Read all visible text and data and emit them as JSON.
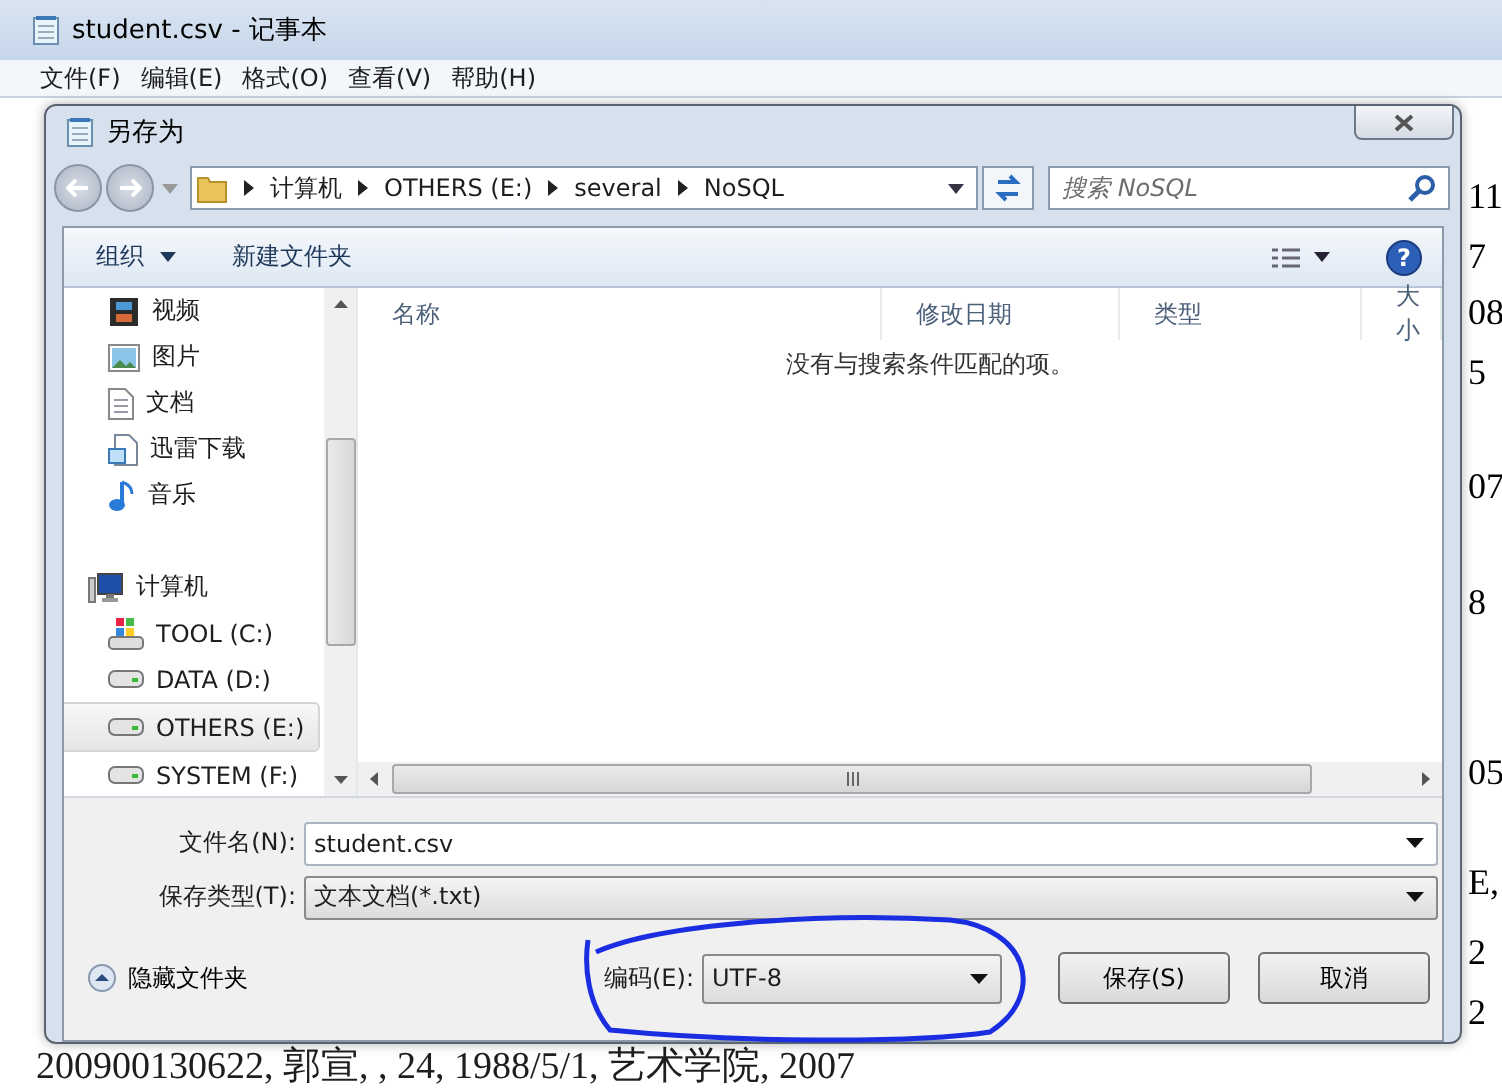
{
  "notepad": {
    "title": "student.csv - 记事本",
    "menu": [
      "文件(F)",
      "编辑(E)",
      "格式(O)",
      "查看(V)",
      "帮助(H)"
    ],
    "right_edge": [
      "11",
      "7",
      "08",
      "5",
      "07",
      "8",
      "05",
      "E,",
      "2",
      "2"
    ],
    "bottom_line": "200900130622, 郭宣, , 24, 1988/5/1, 艺术学院, 2007"
  },
  "dialog": {
    "title": "另存为",
    "breadcrumb": [
      "计算机",
      "OTHERS (E:)",
      "several",
      "NoSQL"
    ],
    "search": {
      "placeholder": "搜索 NoSQL"
    },
    "toolbar": {
      "organize": "组织",
      "new_folder": "新建文件夹",
      "help": "?"
    },
    "nav": [
      {
        "label": "视频",
        "kind": "video",
        "selected": false
      },
      {
        "label": "图片",
        "kind": "picture",
        "selected": false
      },
      {
        "label": "文档",
        "kind": "document",
        "selected": false
      },
      {
        "label": "迅雷下载",
        "kind": "download",
        "selected": false
      },
      {
        "label": "音乐",
        "kind": "music",
        "selected": false
      },
      {
        "label": "计算机",
        "kind": "computer",
        "selected": false
      },
      {
        "label": "TOOL (C:)",
        "kind": "system-drive",
        "selected": false
      },
      {
        "label": "DATA (D:)",
        "kind": "drive",
        "selected": false
      },
      {
        "label": "OTHERS (E:)",
        "kind": "drive",
        "selected": true
      },
      {
        "label": "SYSTEM (F:)",
        "kind": "drive",
        "selected": false
      }
    ],
    "columns": [
      "名称",
      "修改日期",
      "类型",
      "大小"
    ],
    "empty_message": "没有与搜索条件匹配的项。",
    "filename": {
      "label": "文件名(N):",
      "value": "student.csv"
    },
    "filetype": {
      "label": "保存类型(T):",
      "value": "文本文档(*.txt)"
    },
    "hide_folders": "隐藏文件夹",
    "encoding": {
      "label": "编码(E):",
      "value": "UTF-8"
    },
    "buttons": [
      "保存(S)",
      "取消"
    ]
  }
}
